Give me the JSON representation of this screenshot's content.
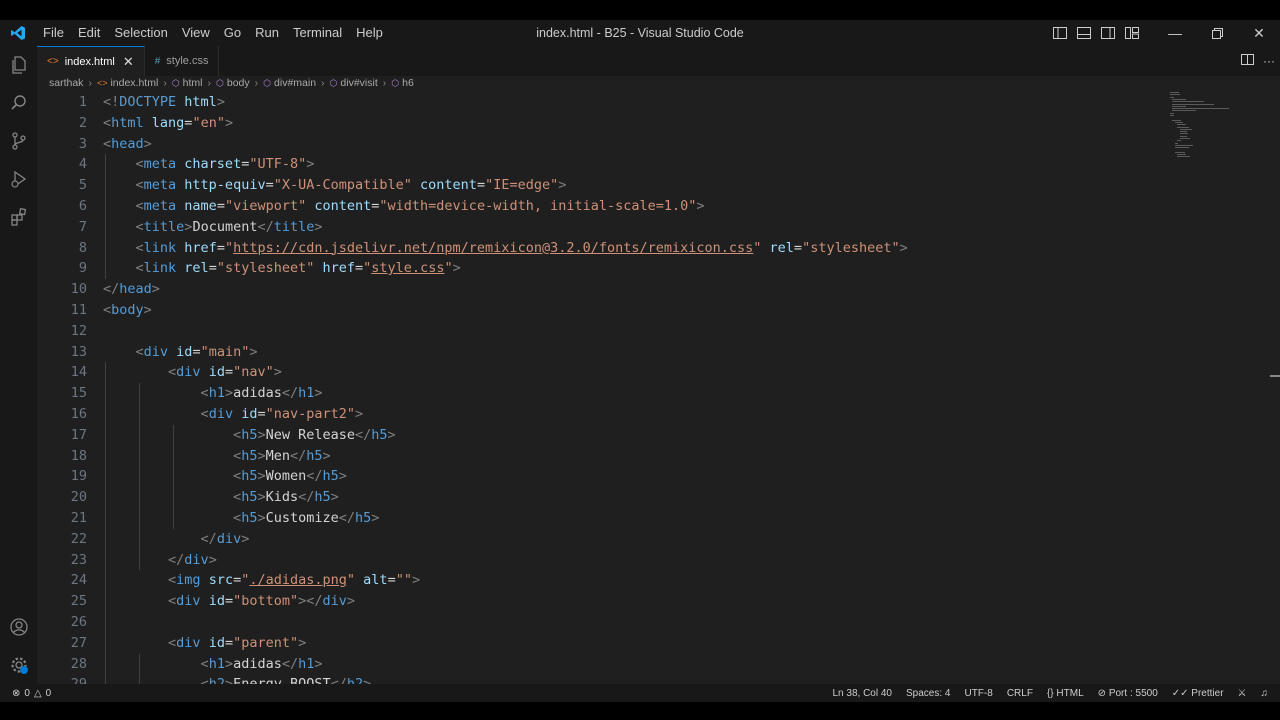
{
  "window": {
    "title": "index.html - B25 - Visual Studio Code"
  },
  "menu": [
    "File",
    "Edit",
    "Selection",
    "View",
    "Go",
    "Run",
    "Terminal",
    "Help"
  ],
  "tabs": [
    {
      "label": "index.html",
      "icon": "html-file-icon",
      "active": true
    },
    {
      "label": "style.css",
      "icon": "css-file-icon",
      "active": false
    }
  ],
  "breadcrumb": [
    "sarthak",
    "index.html",
    "html",
    "body",
    "div#main",
    "div#visit",
    "h6"
  ],
  "editor": {
    "lines": [
      [
        [
          "br",
          "<!"
        ],
        [
          "dt",
          "DOCTYPE "
        ],
        [
          "attr",
          "html"
        ],
        [
          "br",
          ">"
        ]
      ],
      [
        [
          "br",
          "<"
        ],
        [
          "tag",
          "html "
        ],
        [
          "attr",
          "lang"
        ],
        [
          "txt",
          "="
        ],
        [
          "str",
          "\"en\""
        ],
        [
          "br",
          ">"
        ]
      ],
      [
        [
          "br",
          "<"
        ],
        [
          "tag",
          "head"
        ],
        [
          "br",
          ">"
        ]
      ],
      [
        [
          "txt",
          "    "
        ],
        [
          "br",
          "<"
        ],
        [
          "tag",
          "meta "
        ],
        [
          "attr",
          "charset"
        ],
        [
          "txt",
          "="
        ],
        [
          "str",
          "\"UTF-8\""
        ],
        [
          "br",
          ">"
        ]
      ],
      [
        [
          "txt",
          "    "
        ],
        [
          "br",
          "<"
        ],
        [
          "tag",
          "meta "
        ],
        [
          "attr",
          "http-equiv"
        ],
        [
          "txt",
          "="
        ],
        [
          "str",
          "\"X-UA-Compatible\" "
        ],
        [
          "attr",
          "content"
        ],
        [
          "txt",
          "="
        ],
        [
          "str",
          "\"IE=edge\""
        ],
        [
          "br",
          ">"
        ]
      ],
      [
        [
          "txt",
          "    "
        ],
        [
          "br",
          "<"
        ],
        [
          "tag",
          "meta "
        ],
        [
          "attr",
          "name"
        ],
        [
          "txt",
          "="
        ],
        [
          "str",
          "\"viewport\" "
        ],
        [
          "attr",
          "content"
        ],
        [
          "txt",
          "="
        ],
        [
          "str",
          "\"width=device-width, initial-scale=1.0\""
        ],
        [
          "br",
          ">"
        ]
      ],
      [
        [
          "txt",
          "    "
        ],
        [
          "br",
          "<"
        ],
        [
          "tag",
          "title"
        ],
        [
          "br",
          ">"
        ],
        [
          "txt",
          "Document"
        ],
        [
          "br",
          "</"
        ],
        [
          "tag",
          "title"
        ],
        [
          "br",
          ">"
        ]
      ],
      [
        [
          "txt",
          "    "
        ],
        [
          "br",
          "<"
        ],
        [
          "tag",
          "link "
        ],
        [
          "attr",
          "href"
        ],
        [
          "txt",
          "="
        ],
        [
          "str",
          "\""
        ],
        [
          "link",
          "https://cdn.jsdelivr.net/npm/remixicon@3.2.0/fonts/remixicon.css"
        ],
        [
          "str",
          "\" "
        ],
        [
          "attr",
          "rel"
        ],
        [
          "txt",
          "="
        ],
        [
          "str",
          "\"stylesheet\""
        ],
        [
          "br",
          ">"
        ]
      ],
      [
        [
          "txt",
          "    "
        ],
        [
          "br",
          "<"
        ],
        [
          "tag",
          "link "
        ],
        [
          "attr",
          "rel"
        ],
        [
          "txt",
          "="
        ],
        [
          "str",
          "\"stylesheet\" "
        ],
        [
          "attr",
          "href"
        ],
        [
          "txt",
          "="
        ],
        [
          "str",
          "\""
        ],
        [
          "link",
          "style.css"
        ],
        [
          "str",
          "\""
        ],
        [
          "br",
          ">"
        ]
      ],
      [
        [
          "br",
          "</"
        ],
        [
          "tag",
          "head"
        ],
        [
          "br",
          ">"
        ]
      ],
      [
        [
          "br",
          "<"
        ],
        [
          "tag",
          "body"
        ],
        [
          "br",
          ">"
        ]
      ],
      [],
      [
        [
          "txt",
          "    "
        ],
        [
          "br",
          "<"
        ],
        [
          "tag",
          "div "
        ],
        [
          "attr",
          "id"
        ],
        [
          "txt",
          "="
        ],
        [
          "str",
          "\"main\""
        ],
        [
          "br",
          ">"
        ]
      ],
      [
        [
          "txt",
          "        "
        ],
        [
          "br",
          "<"
        ],
        [
          "tag",
          "div "
        ],
        [
          "attr",
          "id"
        ],
        [
          "txt",
          "="
        ],
        [
          "str",
          "\"nav\""
        ],
        [
          "br",
          ">"
        ]
      ],
      [
        [
          "txt",
          "            "
        ],
        [
          "br",
          "<"
        ],
        [
          "tag",
          "h1"
        ],
        [
          "br",
          ">"
        ],
        [
          "txt",
          "adidas"
        ],
        [
          "br",
          "</"
        ],
        [
          "tag",
          "h1"
        ],
        [
          "br",
          ">"
        ]
      ],
      [
        [
          "txt",
          "            "
        ],
        [
          "br",
          "<"
        ],
        [
          "tag",
          "div "
        ],
        [
          "attr",
          "id"
        ],
        [
          "txt",
          "="
        ],
        [
          "str",
          "\"nav-part2\""
        ],
        [
          "br",
          ">"
        ]
      ],
      [
        [
          "txt",
          "                "
        ],
        [
          "br",
          "<"
        ],
        [
          "tag",
          "h5"
        ],
        [
          "br",
          ">"
        ],
        [
          "txt",
          "New Release"
        ],
        [
          "br",
          "</"
        ],
        [
          "tag",
          "h5"
        ],
        [
          "br",
          ">"
        ]
      ],
      [
        [
          "txt",
          "                "
        ],
        [
          "br",
          "<"
        ],
        [
          "tag",
          "h5"
        ],
        [
          "br",
          ">"
        ],
        [
          "txt",
          "Men"
        ],
        [
          "br",
          "</"
        ],
        [
          "tag",
          "h5"
        ],
        [
          "br",
          ">"
        ]
      ],
      [
        [
          "txt",
          "                "
        ],
        [
          "br",
          "<"
        ],
        [
          "tag",
          "h5"
        ],
        [
          "br",
          ">"
        ],
        [
          "txt",
          "Women"
        ],
        [
          "br",
          "</"
        ],
        [
          "tag",
          "h5"
        ],
        [
          "br",
          ">"
        ]
      ],
      [
        [
          "txt",
          "                "
        ],
        [
          "br",
          "<"
        ],
        [
          "tag",
          "h5"
        ],
        [
          "br",
          ">"
        ],
        [
          "txt",
          "Kids"
        ],
        [
          "br",
          "</"
        ],
        [
          "tag",
          "h5"
        ],
        [
          "br",
          ">"
        ]
      ],
      [
        [
          "txt",
          "                "
        ],
        [
          "br",
          "<"
        ],
        [
          "tag",
          "h5"
        ],
        [
          "br",
          ">"
        ],
        [
          "txt",
          "Customize"
        ],
        [
          "br",
          "</"
        ],
        [
          "tag",
          "h5"
        ],
        [
          "br",
          ">"
        ]
      ],
      [
        [
          "txt",
          "            "
        ],
        [
          "br",
          "</"
        ],
        [
          "tag",
          "div"
        ],
        [
          "br",
          ">"
        ]
      ],
      [
        [
          "txt",
          "        "
        ],
        [
          "br",
          "</"
        ],
        [
          "tag",
          "div"
        ],
        [
          "br",
          ">"
        ]
      ],
      [
        [
          "txt",
          "        "
        ],
        [
          "br",
          "<"
        ],
        [
          "tag",
          "img "
        ],
        [
          "attr",
          "src"
        ],
        [
          "txt",
          "="
        ],
        [
          "str",
          "\""
        ],
        [
          "link",
          "./adidas.png"
        ],
        [
          "str",
          "\" "
        ],
        [
          "attr",
          "alt"
        ],
        [
          "txt",
          "="
        ],
        [
          "str",
          "\"\""
        ],
        [
          "br",
          ">"
        ]
      ],
      [
        [
          "txt",
          "        "
        ],
        [
          "br",
          "<"
        ],
        [
          "tag",
          "div "
        ],
        [
          "attr",
          "id"
        ],
        [
          "txt",
          "="
        ],
        [
          "str",
          "\"bottom\""
        ],
        [
          "br",
          "></"
        ],
        [
          "tag",
          "div"
        ],
        [
          "br",
          ">"
        ]
      ],
      [],
      [
        [
          "txt",
          "        "
        ],
        [
          "br",
          "<"
        ],
        [
          "tag",
          "div "
        ],
        [
          "attr",
          "id"
        ],
        [
          "txt",
          "="
        ],
        [
          "str",
          "\"parent\""
        ],
        [
          "br",
          ">"
        ]
      ],
      [
        [
          "txt",
          "            "
        ],
        [
          "br",
          "<"
        ],
        [
          "tag",
          "h1"
        ],
        [
          "br",
          ">"
        ],
        [
          "txt",
          "adidas"
        ],
        [
          "br",
          "</"
        ],
        [
          "tag",
          "h1"
        ],
        [
          "br",
          ">"
        ]
      ],
      [
        [
          "txt",
          "            "
        ],
        [
          "br",
          "<"
        ],
        [
          "tag",
          "h2"
        ],
        [
          "br",
          ">"
        ],
        [
          "txt",
          "Energy BOOST"
        ],
        [
          "br",
          "</"
        ],
        [
          "tag",
          "h2"
        ],
        [
          "br",
          ">"
        ]
      ]
    ]
  },
  "status": {
    "errors": "0",
    "warnings": "0",
    "position": "Ln 38, Col 40",
    "spaces": "Spaces: 4",
    "encoding": "UTF-8",
    "eol": "CRLF",
    "language": "HTML",
    "port": "Port : 5500",
    "formatter": "Prettier"
  },
  "colors": {
    "accent": "#0078d4",
    "tag": "#569cd6",
    "attr": "#9cdcfe",
    "string": "#ce9178"
  }
}
